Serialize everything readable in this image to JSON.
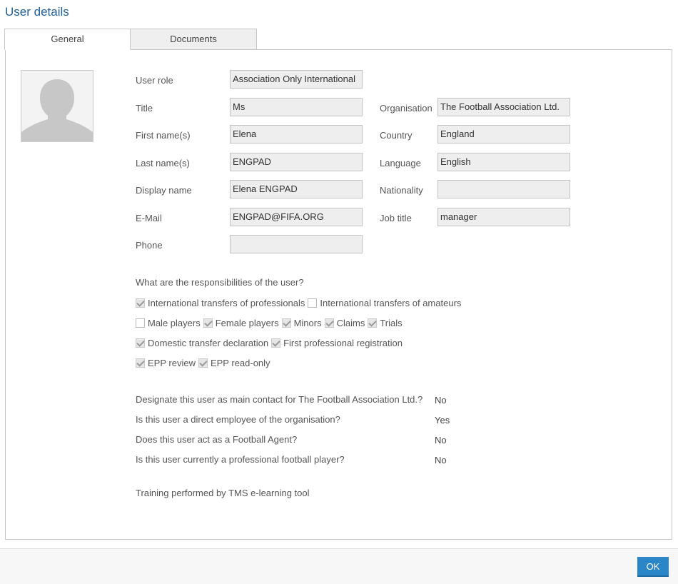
{
  "dialog": {
    "title": "User details",
    "ok_label": "OK"
  },
  "tabs": [
    {
      "label": "General",
      "active": true
    },
    {
      "label": "Documents",
      "active": false
    }
  ],
  "avatar": {
    "icon": "user-silhouette-icon"
  },
  "fields": {
    "user_role": {
      "label": "User role",
      "value": "Association Only International"
    },
    "title": {
      "label": "Title",
      "value": "Ms"
    },
    "first_name": {
      "label": "First name(s)",
      "value": "Elena"
    },
    "last_name": {
      "label": "Last name(s)",
      "value": "ENGPAD"
    },
    "display_name": {
      "label": "Display name",
      "value": "Elena ENGPAD"
    },
    "email": {
      "label": "E-Mail",
      "value": "ENGPAD@FIFA.ORG"
    },
    "phone": {
      "label": "Phone",
      "value": ""
    },
    "organisation": {
      "label": "Organisation",
      "value": "The Football Association Ltd."
    },
    "country": {
      "label": "Country",
      "value": "England"
    },
    "language": {
      "label": "Language",
      "value": "English"
    },
    "nationality": {
      "label": "Nationality",
      "value": ""
    },
    "job_title": {
      "label": "Job title",
      "value": "manager"
    }
  },
  "responsibilities": {
    "question": "What are the responsibilities of the user?",
    "rows": [
      [
        {
          "label": "International transfers of professionals",
          "checked": true
        },
        {
          "label": "International transfers of amateurs",
          "checked": false
        }
      ],
      [
        {
          "label": "Male players",
          "checked": false
        },
        {
          "label": "Female players",
          "checked": true
        },
        {
          "label": "Minors",
          "checked": true
        },
        {
          "label": "Claims",
          "checked": true
        },
        {
          "label": "Trials",
          "checked": true
        }
      ],
      [
        {
          "label": "Domestic transfer declaration",
          "checked": true
        },
        {
          "label": "First professional registration",
          "checked": true
        }
      ],
      [
        {
          "label": "EPP review",
          "checked": true
        },
        {
          "label": "EPP read-only",
          "checked": true
        }
      ]
    ]
  },
  "questions": [
    {
      "text": "Designate this user as main contact for The Football Association Ltd.?",
      "answer": "No"
    },
    {
      "text": "Is this user a direct employee of the organisation?",
      "answer": "Yes"
    },
    {
      "text": "Does this user act as a Football Agent?",
      "answer": "No"
    },
    {
      "text": "Is this user currently a professional football player?",
      "answer": "No"
    }
  ],
  "training": {
    "text": "Training performed by TMS e-learning tool"
  },
  "colors": {
    "title": "#1f5f94",
    "ok_button": "#2a86c6",
    "field_bg": "#eeeeee"
  }
}
